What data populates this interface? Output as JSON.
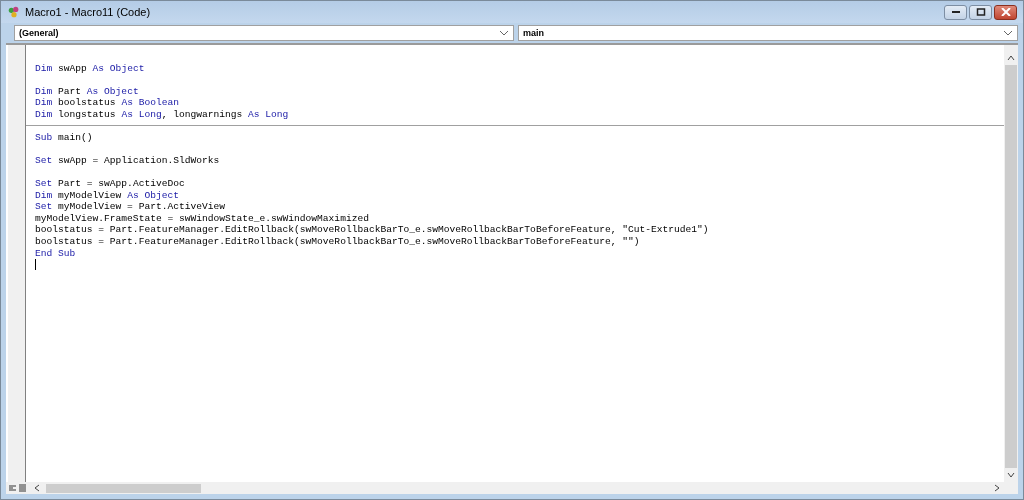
{
  "window": {
    "title": "Macro1 - Macro11 (Code)"
  },
  "object_combo": {
    "value": "(General)"
  },
  "procedure_combo": {
    "value": "main"
  },
  "code_sections": [
    {
      "lines": [
        {
          "kind": "blank"
        },
        {
          "kind": "code",
          "tokens": [
            {
              "kind": "keyword",
              "text": "Dim"
            },
            {
              "kind": "plain",
              "text": " swApp "
            },
            {
              "kind": "keyword",
              "text": "As Object"
            }
          ]
        },
        {
          "kind": "blank"
        },
        {
          "kind": "code",
          "tokens": [
            {
              "kind": "keyword",
              "text": "Dim"
            },
            {
              "kind": "plain",
              "text": " Part "
            },
            {
              "kind": "keyword",
              "text": "As Object"
            }
          ]
        },
        {
          "kind": "code",
          "tokens": [
            {
              "kind": "keyword",
              "text": "Dim"
            },
            {
              "kind": "plain",
              "text": " boolstatus "
            },
            {
              "kind": "keyword",
              "text": "As Boolean"
            }
          ]
        },
        {
          "kind": "code",
          "tokens": [
            {
              "kind": "keyword",
              "text": "Dim"
            },
            {
              "kind": "plain",
              "text": " longstatus "
            },
            {
              "kind": "keyword",
              "text": "As Long"
            },
            {
              "kind": "plain",
              "text": ", longwarnings "
            },
            {
              "kind": "keyword",
              "text": "As Long"
            }
          ]
        }
      ]
    },
    {
      "lines": [
        {
          "kind": "code",
          "tokens": [
            {
              "kind": "keyword",
              "text": "Sub"
            },
            {
              "kind": "plain",
              "text": " main()"
            }
          ]
        },
        {
          "kind": "blank"
        },
        {
          "kind": "code",
          "tokens": [
            {
              "kind": "keyword",
              "text": "Set"
            },
            {
              "kind": "plain",
              "text": " swApp = Application.SldWorks"
            }
          ]
        },
        {
          "kind": "blank"
        },
        {
          "kind": "code",
          "tokens": [
            {
              "kind": "keyword",
              "text": "Set"
            },
            {
              "kind": "plain",
              "text": " Part = swApp.ActiveDoc"
            }
          ]
        },
        {
          "kind": "code",
          "tokens": [
            {
              "kind": "keyword",
              "text": "Dim"
            },
            {
              "kind": "plain",
              "text": " myModelView "
            },
            {
              "kind": "keyword",
              "text": "As Object"
            }
          ]
        },
        {
          "kind": "code",
          "tokens": [
            {
              "kind": "keyword",
              "text": "Set"
            },
            {
              "kind": "plain",
              "text": " myModelView = Part.ActiveView"
            }
          ]
        },
        {
          "kind": "code",
          "tokens": [
            {
              "kind": "plain",
              "text": "myModelView.FrameState = swWindowState_e.swWindowMaximized"
            }
          ]
        },
        {
          "kind": "code",
          "tokens": [
            {
              "kind": "plain",
              "text": "boolstatus = Part.FeatureManager.EditRollback(swMoveRollbackBarTo_e.swMoveRollbackBarToBeforeFeature, \"Cut-Extrude1\")"
            }
          ]
        },
        {
          "kind": "code",
          "tokens": [
            {
              "kind": "plain",
              "text": "boolstatus = Part.FeatureManager.EditRollback(swMoveRollbackBarTo_e.swMoveRollbackBarToBeforeFeature, \"\")"
            }
          ]
        },
        {
          "kind": "code",
          "tokens": [
            {
              "kind": "keyword",
              "text": "End Sub"
            }
          ]
        },
        {
          "kind": "cursor"
        }
      ]
    }
  ]
}
